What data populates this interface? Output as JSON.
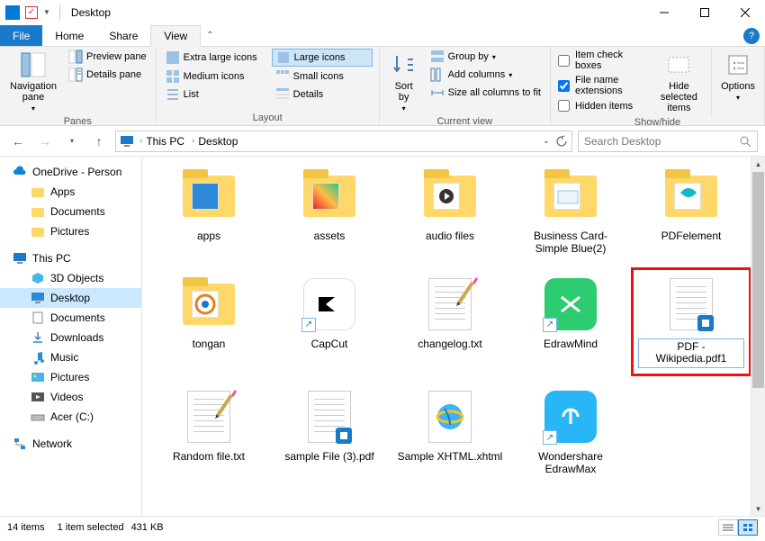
{
  "window": {
    "title": "Desktop"
  },
  "tabs": {
    "file": "File",
    "home": "Home",
    "share": "Share",
    "view": "View"
  },
  "ribbon": {
    "panes": {
      "nav_pane": "Navigation pane",
      "preview": "Preview pane",
      "details": "Details pane",
      "group_label": "Panes"
    },
    "layout": {
      "xl": "Extra large icons",
      "large": "Large icons",
      "medium": "Medium icons",
      "small": "Small icons",
      "list": "List",
      "details": "Details",
      "group_label": "Layout"
    },
    "current_view": {
      "sort_by": "Sort by",
      "group_by": "Group by",
      "add_columns": "Add columns",
      "size_all": "Size all columns to fit",
      "group_label": "Current view"
    },
    "show_hide": {
      "item_checkboxes": "Item check boxes",
      "file_ext": "File name extensions",
      "hidden_items": "Hidden items",
      "hide_selected": "Hide selected items",
      "options": "Options",
      "group_label": "Show/hide"
    }
  },
  "address": {
    "crumbs": [
      "This PC",
      "Desktop"
    ],
    "search_placeholder": "Search Desktop"
  },
  "nav": {
    "onedrive": "OneDrive - Person",
    "apps": "Apps",
    "documents": "Documents",
    "pictures": "Pictures",
    "this_pc": "This PC",
    "objects3d": "3D Objects",
    "desktop": "Desktop",
    "documents2": "Documents",
    "downloads": "Downloads",
    "music": "Music",
    "pictures2": "Pictures",
    "videos": "Videos",
    "acer": "Acer (C:)",
    "network": "Network"
  },
  "items": [
    {
      "name": "apps",
      "type": "folder"
    },
    {
      "name": "assets",
      "type": "folder"
    },
    {
      "name": "audio files",
      "type": "folder"
    },
    {
      "name": "Business Card-Simple Blue(2)",
      "type": "folder"
    },
    {
      "name": "PDFelement",
      "type": "folder"
    },
    {
      "name": "tongan",
      "type": "folder"
    },
    {
      "name": "CapCut",
      "type": "app"
    },
    {
      "name": "changelog.txt",
      "type": "txt"
    },
    {
      "name": "EdrawMind",
      "type": "app"
    },
    {
      "name": "PDF - Wikipedia.pdf1",
      "type": "pdf",
      "selected": true
    },
    {
      "name": "Random file.txt",
      "type": "txt"
    },
    {
      "name": "sample File (3).pdf",
      "type": "pdf"
    },
    {
      "name": "Sample XHTML.xhtml",
      "type": "html"
    },
    {
      "name": "Wondershare EdrawMax",
      "type": "app"
    }
  ],
  "status": {
    "count": "14 items",
    "selection": "1 item selected",
    "size": "431 KB"
  },
  "checkboxes": {
    "file_ext_checked": true
  }
}
